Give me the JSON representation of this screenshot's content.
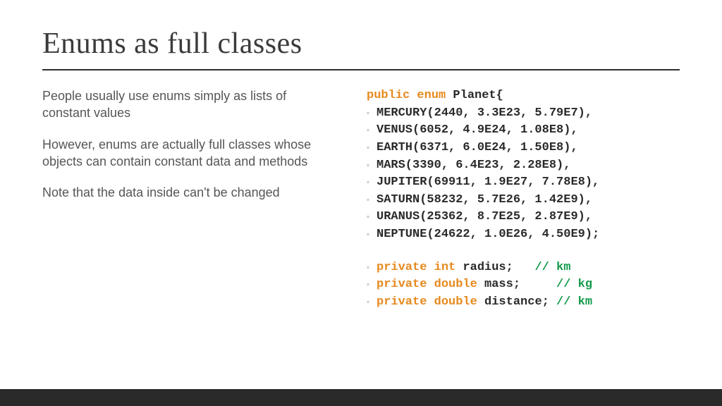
{
  "title": "Enums as full classes",
  "paragraphs": [
    "People usually use enums simply as lists of constant values",
    "However, enums are actually full classes whose objects can contain constant data and methods",
    "Note that the data inside can't be changed"
  ],
  "code": {
    "decl": {
      "kw": "public enum",
      "name": "Planet",
      "brace": " {"
    },
    "constants": [
      "MERCURY(2440, 3.3E23, 5.79E7),",
      "VENUS(6052, 4.9E24, 1.08E8),",
      "EARTH(6371, 6.0E24, 1.50E8),",
      "MARS(3390, 6.4E23, 2.28E8),",
      "JUPITER(69911, 1.9E27, 7.78E8),",
      "SATURN(58232, 5.7E26, 1.42E9),",
      "URANUS(25362, 8.7E25, 2.87E9),",
      "NEPTUNE(24622, 1.0E26, 4.50E9);"
    ],
    "fields": [
      {
        "kw": "private int",
        "name": " radius;   ",
        "cm": "// km"
      },
      {
        "kw": "private double",
        "name": " mass;     ",
        "cm": "// kg"
      },
      {
        "kw": "private double",
        "name": " distance; ",
        "cm": "// km"
      }
    ]
  }
}
